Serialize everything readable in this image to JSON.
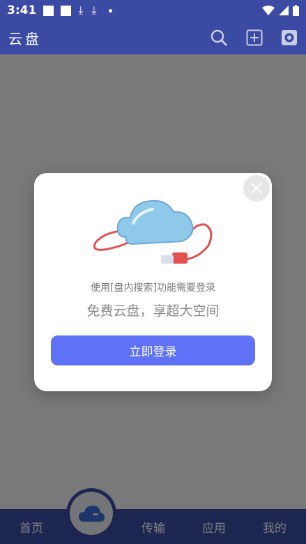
{
  "status_bar": {
    "time": "3:41"
  },
  "app_bar": {
    "title": "云盘",
    "icons": [
      "search-icon",
      "add-icon",
      "settings-icon"
    ]
  },
  "dialog": {
    "message_small": "使用[盘内搜索]功能需要登录",
    "message_large": "免费云盘，享超大空间",
    "login_button": "立即登录",
    "close_icon": "close-icon"
  },
  "bottom_nav": {
    "items": [
      {
        "label": "首页"
      },
      {
        "label": "传输"
      },
      {
        "label": "应用"
      },
      {
        "label": "我的"
      }
    ],
    "center_icon": "cloud-icon"
  },
  "colors": {
    "primary": "#3b4aa3",
    "button": "#5f72f5"
  }
}
